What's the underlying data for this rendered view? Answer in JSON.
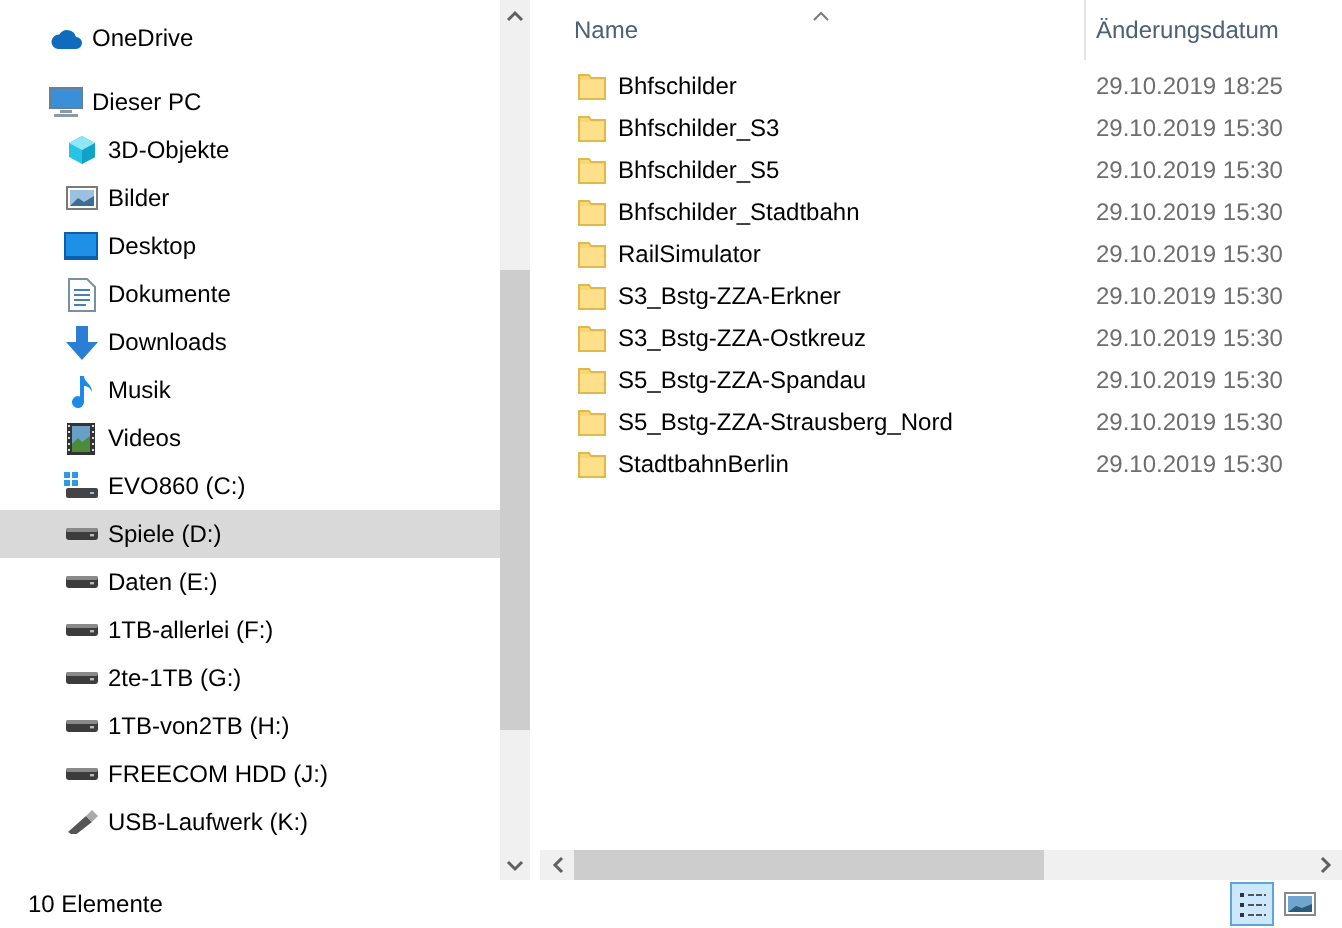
{
  "navigation": [
    {
      "label": "OneDrive",
      "kind": "cloud",
      "selected": false
    },
    {
      "label": "Dieser PC",
      "kind": "pc",
      "selected": false,
      "children": [
        {
          "label": "3D-Objekte",
          "kind": "cube",
          "selected": false
        },
        {
          "label": "Bilder",
          "kind": "pictures",
          "selected": false
        },
        {
          "label": "Desktop",
          "kind": "desktop",
          "selected": false
        },
        {
          "label": "Dokumente",
          "kind": "document",
          "selected": false
        },
        {
          "label": "Downloads",
          "kind": "download",
          "selected": false
        },
        {
          "label": "Musik",
          "kind": "music",
          "selected": false
        },
        {
          "label": "Videos",
          "kind": "video",
          "selected": false
        },
        {
          "label": "EVO860 (C:)",
          "kind": "system-drive",
          "selected": false
        },
        {
          "label": "Spiele (D:)",
          "kind": "drive",
          "selected": true
        },
        {
          "label": "Daten (E:)",
          "kind": "drive",
          "selected": false
        },
        {
          "label": "1TB-allerlei (F:)",
          "kind": "drive",
          "selected": false
        },
        {
          "label": "2te-1TB (G:)",
          "kind": "drive",
          "selected": false
        },
        {
          "label": "1TB-von2TB (H:)",
          "kind": "drive",
          "selected": false
        },
        {
          "label": "FREECOM HDD (J:)",
          "kind": "drive",
          "selected": false
        },
        {
          "label": "USB-Laufwerk (K:)",
          "kind": "usb",
          "selected": false
        }
      ]
    }
  ],
  "file_list": {
    "columns": [
      "Name",
      "Änderungsdatum"
    ],
    "rows": [
      {
        "name": "Bhfschilder",
        "modified": "29.10.2019 18:25"
      },
      {
        "name": "Bhfschilder_S3",
        "modified": "29.10.2019 15:30"
      },
      {
        "name": "Bhfschilder_S5",
        "modified": "29.10.2019 15:30"
      },
      {
        "name": "Bhfschilder_Stadtbahn",
        "modified": "29.10.2019 15:30"
      },
      {
        "name": "RailSimulator",
        "modified": "29.10.2019 15:30"
      },
      {
        "name": "S3_Bstg-ZZA-Erkner",
        "modified": "29.10.2019 15:30"
      },
      {
        "name": "S3_Bstg-ZZA-Ostkreuz",
        "modified": "29.10.2019 15:30"
      },
      {
        "name": "S5_Bstg-ZZA-Spandau",
        "modified": "29.10.2019 15:30"
      },
      {
        "name": "S5_Bstg-ZZA-Strausberg_Nord",
        "modified": "29.10.2019 15:30"
      },
      {
        "name": "StadtbahnBerlin",
        "modified": "29.10.2019 15:30"
      }
    ]
  },
  "status_bar": {
    "item_count": "10 Elemente",
    "views": [
      {
        "kind": "details",
        "selected": true
      },
      {
        "kind": "tiles",
        "selected": false
      }
    ]
  }
}
